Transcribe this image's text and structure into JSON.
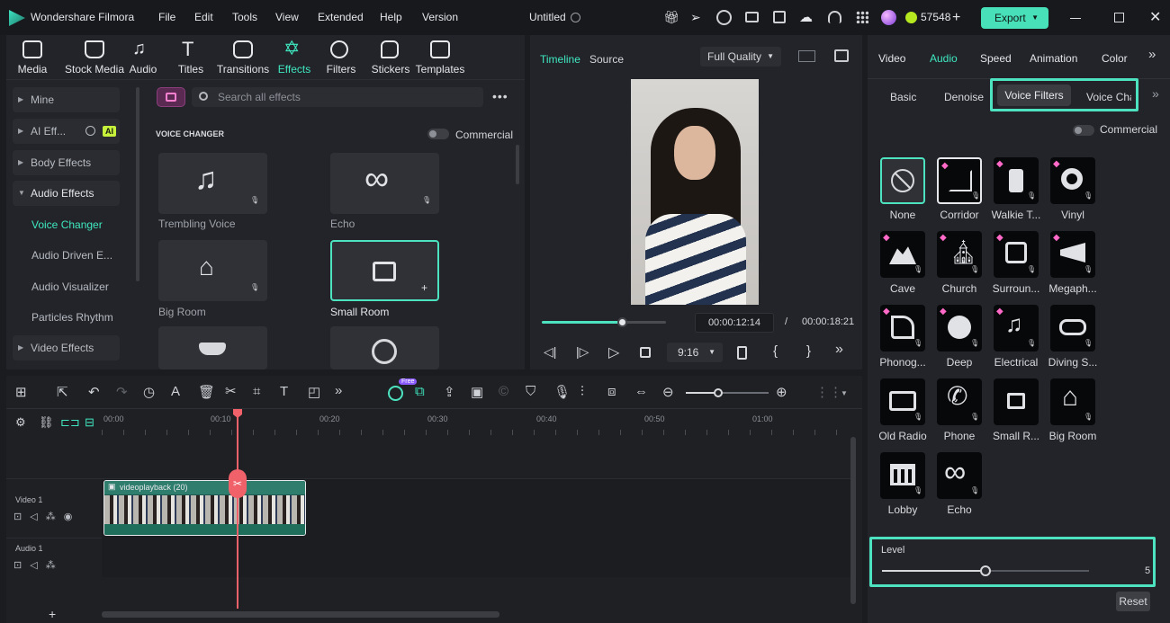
{
  "app": {
    "name": "Wondershare Filmora",
    "project_title": "Untitled",
    "credits": "57548",
    "export_label": "Export"
  },
  "menu": [
    "File",
    "Edit",
    "Tools",
    "View",
    "Extended",
    "Help",
    "Version"
  ],
  "media_tabs": [
    {
      "label": "Media",
      "icon": "media-icon"
    },
    {
      "label": "Stock Media",
      "icon": "stock-media-icon"
    },
    {
      "label": "Audio",
      "icon": "audio-icon"
    },
    {
      "label": "Titles",
      "icon": "titles-icon"
    },
    {
      "label": "Transitions",
      "icon": "transitions-icon"
    },
    {
      "label": "Effects",
      "icon": "effects-icon"
    },
    {
      "label": "Filters",
      "icon": "filters-icon"
    },
    {
      "label": "Stickers",
      "icon": "stickers-icon"
    },
    {
      "label": "Templates",
      "icon": "templates-icon"
    }
  ],
  "sidebar": {
    "items": [
      {
        "label": "Mine"
      },
      {
        "label": "AI Eff...",
        "badge": "AI"
      },
      {
        "label": "Body Effects"
      },
      {
        "label": "Audio Effects"
      }
    ],
    "sub_items": [
      "Voice Changer",
      "Audio Driven E...",
      "Audio Visualizer",
      "Particles Rhythm"
    ],
    "last": "Video Effects"
  },
  "effects": {
    "search_placeholder": "Search all effects",
    "section": "VOICE CHANGER",
    "commercial": "Commercial",
    "cards": [
      "Trembling Voice",
      "Echo",
      "Big Room",
      "Small Room"
    ]
  },
  "preview": {
    "tabs": [
      "Timeline",
      "Source"
    ],
    "quality": "Full Quality",
    "current_time": "00:00:12:14",
    "separator": "/",
    "total_time": "00:00:18:21",
    "aspect": "9:16",
    "progress": 0.65
  },
  "right_panel": {
    "tabs": [
      "Video",
      "Audio",
      "Speed",
      "Animation",
      "Color"
    ],
    "subtabs": [
      "Basic",
      "Denoise",
      "Voice Filters",
      "Voice Cha"
    ],
    "commercial": "Commercial",
    "filters": [
      "None",
      "Corridor",
      "Walkie T...",
      "Vinyl",
      "Cave",
      "Church",
      "Surroun...",
      "Megaph...",
      "Phonog...",
      "Deep",
      "Electrical",
      "Diving S...",
      "Old Radio",
      "Phone",
      "Small R...",
      "Big Room",
      "Lobby",
      "Echo"
    ],
    "level_label": "Level",
    "level_value": "5",
    "reset_label": "Reset"
  },
  "timeline": {
    "ruler": [
      "00:00",
      "00:10",
      "00:20",
      "00:30",
      "00:40",
      "00:50",
      "01:00"
    ],
    "tracks": [
      "Video 1",
      "Audio 1"
    ],
    "clip_label": "videoplayback (20)",
    "free_badge": "Free"
  }
}
